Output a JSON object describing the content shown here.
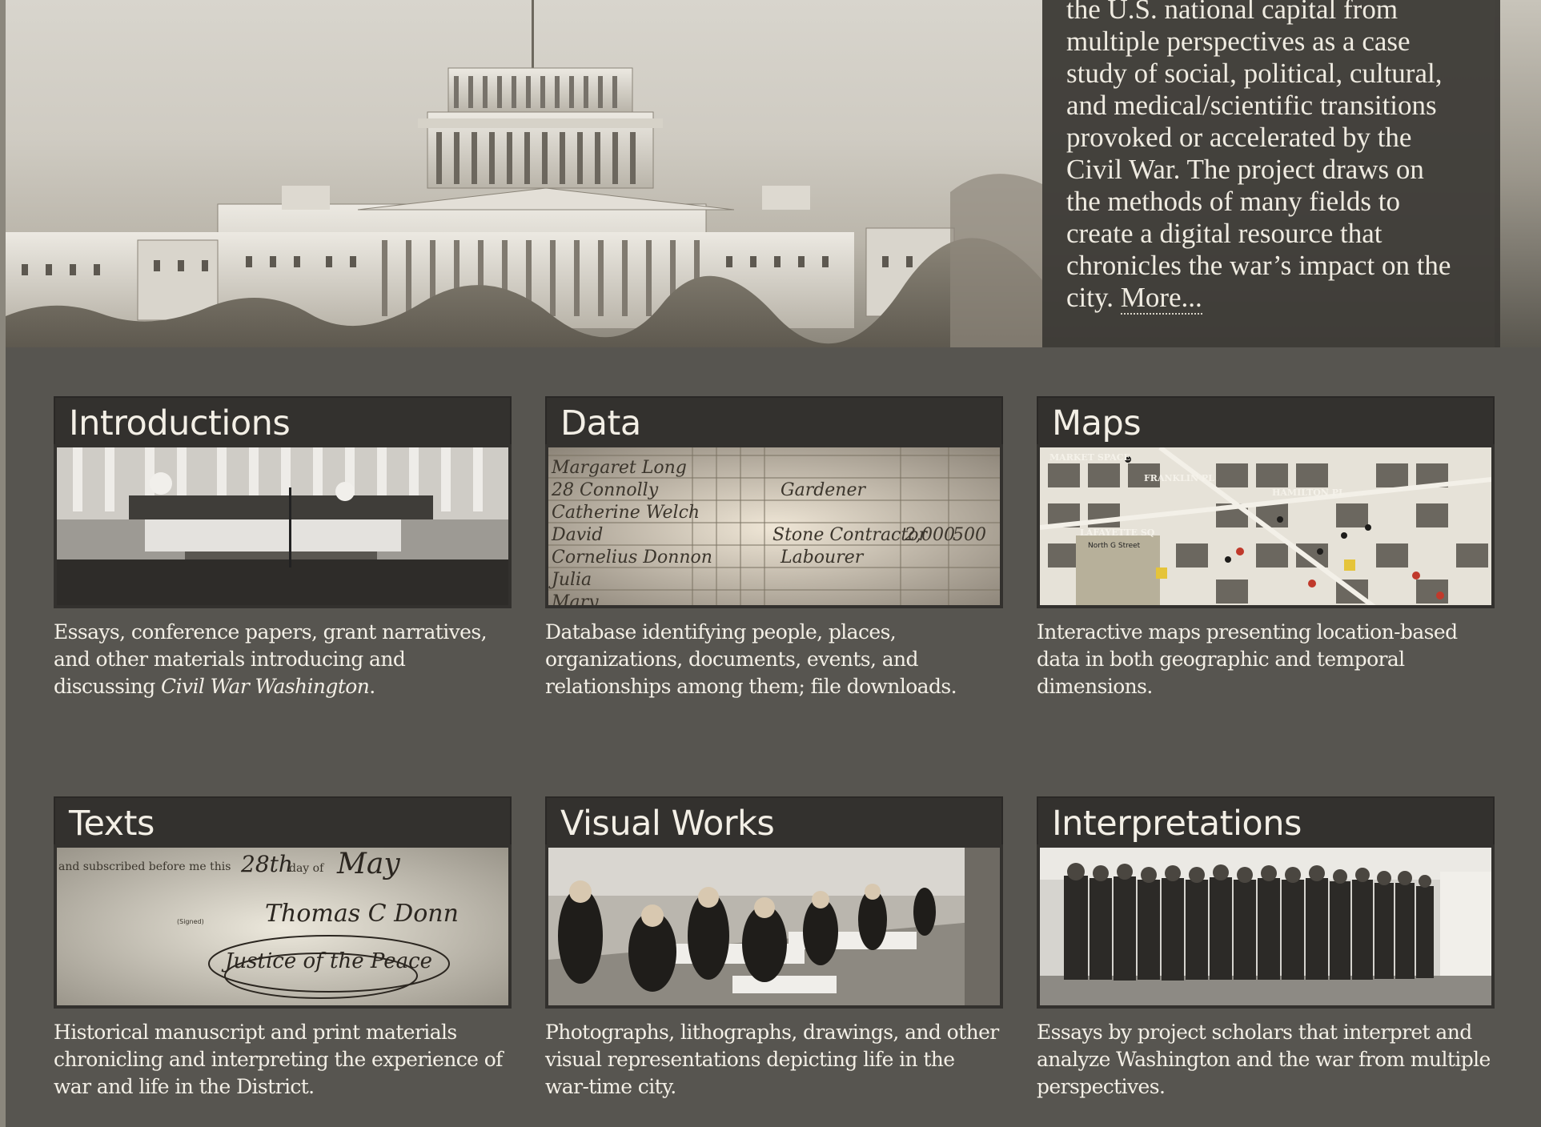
{
  "about": {
    "lines": [
      "the U.S. national capital from",
      "multiple perspectives as a case",
      "study of social, political, cultural,",
      "and medical/scientific transitions",
      "provoked or accelerated by the",
      "Civil War. The project draws on",
      "the methods of many fields to",
      "create a digital resource that",
      "chronicles the war’s impact on the",
      "city."
    ],
    "more_link": "More..."
  },
  "cards": [
    {
      "title": "Introductions",
      "image": "capitol-inauguration-photo",
      "desc_before": "Essays, conference papers, grant narratives, and other materials introducing and discussing ",
      "desc_italic": "Civil War Washington",
      "desc_after": "."
    },
    {
      "title": "Data",
      "image": "census-ledger-photo",
      "desc_before": "Database identifying people, places, organizations, documents, events, and relationships among them; file downloads.",
      "desc_italic": "",
      "desc_after": ""
    },
    {
      "title": "Maps",
      "image": "city-map-image",
      "desc_before": "Interactive maps presenting location-based data in both geographic and temporal dimensions.",
      "desc_italic": "",
      "desc_after": ""
    },
    {
      "title": "Texts",
      "image": "handwritten-document-image",
      "desc_before": "Historical manuscript and print materials chronicling and interpreting the experience of war and life in the District.",
      "desc_italic": "",
      "desc_after": ""
    },
    {
      "title": "Visual Works",
      "image": "hospital-ward-photo",
      "desc_before": "Photographs, lithographs, drawings, and other visual representations depicting life in the war-time city.",
      "desc_italic": "",
      "desc_after": ""
    },
    {
      "title": "Interpretations",
      "image": "soldiers-row-photo",
      "desc_before": "Essays by project scholars that interpret and analyze Washington and the war from multiple perspectives.",
      "desc_italic": "",
      "desc_after": ""
    }
  ],
  "images": {
    "data_ledger_rows": [
      "Margaret Long",
      "28 Connolly",
      "Catherine Welch",
      "David",
      "Cornelius Donnon",
      "Julia",
      "Mary"
    ],
    "data_ledger_cells": [
      "Gardener",
      "Stone Contractor",
      "Labourer",
      "2,000",
      "500"
    ],
    "map_labels": [
      "MARKET SPACE",
      "FRANKLIN PL",
      "HAMILTON PL",
      "LAFAYETTE SQ",
      "North G Street"
    ],
    "text_doc_print": "and subscribed before me this",
    "text_doc_day": "28th",
    "text_doc_dayof": "day of",
    "text_doc_month": "May",
    "text_doc_signed": "(Signed)",
    "text_doc_name": "Thomas C Donn",
    "text_doc_title": "Justice of the Peace"
  }
}
